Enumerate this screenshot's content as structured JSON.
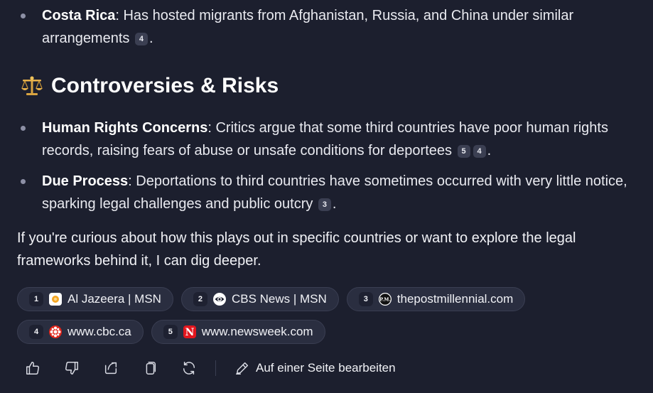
{
  "list1": {
    "items": [
      {
        "term": "Costa Rica",
        "text": ": Has hosted migrants from Afghanistan, Russia, and China under similar arrangements",
        "citations": [
          "4"
        ]
      }
    ]
  },
  "section": {
    "icon": "balance-scale-icon",
    "title": "Controversies & Risks"
  },
  "list2": {
    "items": [
      {
        "term": "Human Rights Concerns",
        "text": ": Critics argue that some third countries have poor human rights records, raising fears of abuse or unsafe conditions for deportees",
        "citations": [
          "5",
          "4"
        ]
      },
      {
        "term": "Due Process",
        "text": ": Deportations to third countries have sometimes occurred with very little notice, sparking legal challenges and public outcry",
        "citations": [
          "3"
        ]
      }
    ]
  },
  "closing": "If you're curious about how this plays out in specific countries or want to explore the legal frameworks behind it, I can dig deeper.",
  "sources": [
    {
      "num": "1",
      "label": "Al Jazeera | MSN",
      "icon": "aljazeera-icon"
    },
    {
      "num": "2",
      "label": "CBS News | MSN",
      "icon": "cbs-eye-icon"
    },
    {
      "num": "3",
      "label": "thepostmillennial.com",
      "icon": "pm-logo-icon",
      "icon_text": "P.M."
    },
    {
      "num": "4",
      "label": "www.cbc.ca",
      "icon": "cbc-gem-icon"
    },
    {
      "num": "5",
      "label": "www.newsweek.com",
      "icon": "newsweek-icon",
      "icon_text": "N"
    }
  ],
  "toolbar": {
    "icons": [
      "thumbs-up-icon",
      "thumbs-down-icon",
      "share-icon",
      "copy-icon",
      "regenerate-icon"
    ],
    "edit_label": "Auf einer Seite bearbeiten"
  },
  "colors": {
    "background": "#1c1f2e",
    "chip": "#2a2e40",
    "badge": "#3b3f52",
    "newsweek_red": "#e2161e",
    "aljazeera_orange": "#f5a623"
  }
}
